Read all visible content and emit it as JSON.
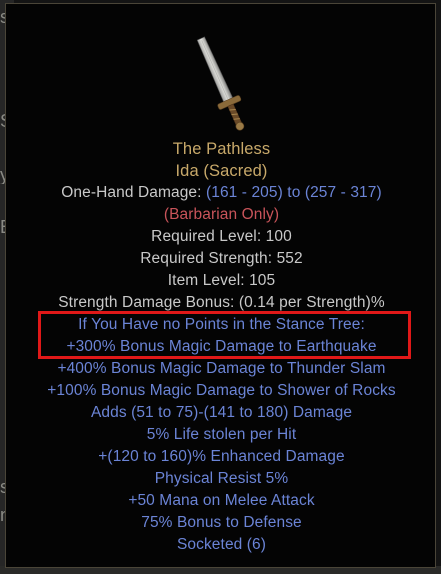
{
  "colors": {
    "item_name": "#c8a96a",
    "base_stat": "#c9c9c9",
    "magic_stat": "#6b84d6",
    "class_restriction": "#c9545a",
    "highlight_box": "#e01818"
  },
  "item": {
    "icon": "sword-icon",
    "name": "The Pathless",
    "base_type": "Ida (Sacred)",
    "damage_label": "One-Hand Damage: ",
    "damage_value": "(161 - 205) to (257 - 317)",
    "class_restriction": "(Barbarian Only)",
    "required_level": "Required Level: 100",
    "required_strength": "Required Strength: 552",
    "item_level": "Item Level: 105",
    "strength_bonus": "Strength Damage Bonus: (0.14 per Strength)%",
    "mods": [
      "If You Have no Points in the Stance Tree:",
      "+300% Bonus Magic Damage to Earthquake",
      "+400% Bonus Magic Damage to Thunder Slam",
      "+100% Bonus Magic Damage to Shower of Rocks",
      "Adds (51 to 75)-(141 to 180) Damage",
      "5% Life stolen per Hit",
      "+(120 to 160)% Enhanced Damage",
      "Physical Resist 5%",
      "+50 Mana on Melee Attack",
      "75% Bonus to Defense",
      "Socketed (6)"
    ]
  },
  "background": {
    "fragments": [
      "s",
      "S",
      "y",
      "E",
      "s",
      "n"
    ]
  }
}
